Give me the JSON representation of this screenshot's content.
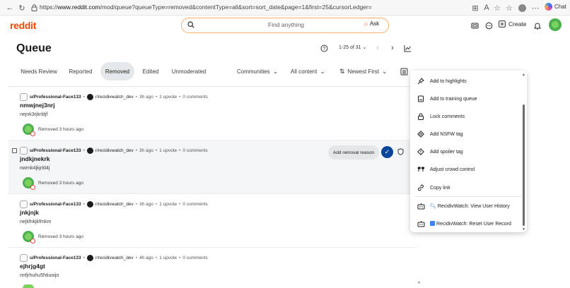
{
  "browser": {
    "url_prefix": "https://",
    "url_host": "www.reddit.com",
    "url_path": "/mod/queue?queueType=removed&contentType=all&sort=sort_date&page=1&first=25&cursorLedger=",
    "chat_label": "Chat"
  },
  "header": {
    "logo": "reddit",
    "search_placeholder": "Find anything",
    "ask_label": "Ask",
    "create_label": "Create"
  },
  "queue": {
    "title": "Queue",
    "pagination": "1-25 of 31"
  },
  "tabs": [
    {
      "label": "Needs Review",
      "active": false
    },
    {
      "label": "Reported",
      "active": false
    },
    {
      "label": "Removed",
      "active": true
    },
    {
      "label": "Edited",
      "active": false
    },
    {
      "label": "Unmoderated",
      "active": false
    }
  ],
  "filters": {
    "communities": "Communities",
    "content": "All content",
    "sort": "Newest First"
  },
  "posts": [
    {
      "user": "u/Professional-Face133",
      "subreddit": "r/recidivwatch_dev",
      "time": "3h ago",
      "upvotes": "1 upvote",
      "comments": "0 comments",
      "title": "nmwjnej3nrj",
      "body": "nejnk3rjkrldjf",
      "removed": "Removed 3 hours ago"
    },
    {
      "user": "u/Professional-Face133",
      "subreddit": "r/recidivwatch_dev",
      "time": "3h ago",
      "upvotes": "1 upvote",
      "comments": "0 comments",
      "title": "jndkjnekrk",
      "body": "nwrnk4jkjrld4j",
      "removed": "Removed 3 hours ago"
    },
    {
      "user": "u/Professional-Face133",
      "subreddit": "r/recidivwatch_dev",
      "time": "3h ago",
      "upvotes": "1 upvote",
      "comments": "0 comments",
      "title": "jnkjnjk",
      "body": "nejkfnkjkfmkm",
      "removed": "Removed 3 hours ago"
    },
    {
      "user": "u/Professional-Face133",
      "subreddit": "r/recidivwatch_dev",
      "time": "4h ago",
      "upvotes": "1 upvote",
      "comments": "0 comments",
      "title": "ejhrjg4gt",
      "body": "nnfjrhuhu5htiuoijo",
      "removed": ""
    }
  ],
  "hover_actions": {
    "add_removal_reason": "Add removal reason"
  },
  "menu": {
    "items": [
      {
        "icon": "pin-icon",
        "label": "Add to highlights"
      },
      {
        "icon": "training-queue-icon",
        "label": "Add to training queue"
      },
      {
        "icon": "lock-icon",
        "label": "Lock comments"
      },
      {
        "icon": "nsfw-tag-icon",
        "label": "Add NSFW tag"
      },
      {
        "icon": "spoiler-tag-icon",
        "label": "Add spoiler tag"
      },
      {
        "icon": "crowd-control-icon",
        "label": "Adjust crowd control"
      },
      {
        "icon": "link-icon",
        "label": "Copy link"
      },
      {
        "icon": "bot-icon",
        "label": "RecidivWatch: View User History"
      },
      {
        "icon": "bot-icon",
        "label": "RecidivWatch: Reset User Record"
      }
    ]
  },
  "colors": {
    "brand": "#ff4500",
    "approve": "#0a449b",
    "active_tab_bg": "#e5e8ea"
  }
}
